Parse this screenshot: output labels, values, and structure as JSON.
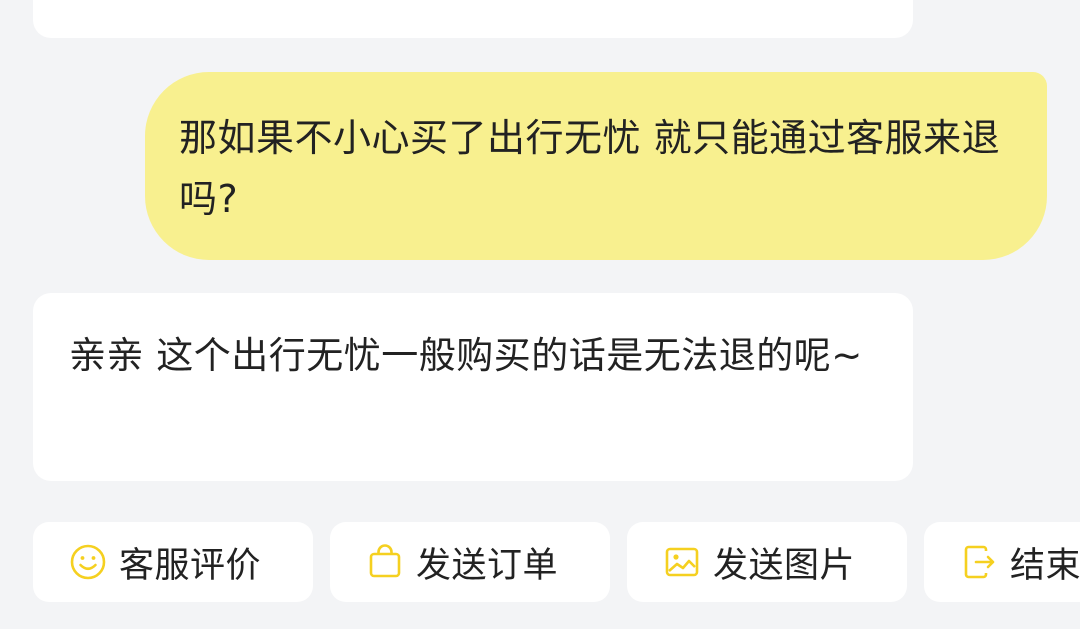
{
  "chat": {
    "messages": [
      {
        "role": "user",
        "text": "那如果不小心买了出行无忧 就只能通过客服来退吗?"
      },
      {
        "role": "agent",
        "text": "亲亲 这个出行无忧一般购买的话是无法退的呢~"
      }
    ]
  },
  "quick_actions": [
    {
      "label": "客服评价",
      "icon": "smiley-icon"
    },
    {
      "label": "发送订单",
      "icon": "shopping-bag-icon"
    },
    {
      "label": "发送图片",
      "icon": "image-icon"
    },
    {
      "label": "结束",
      "icon": "exit-icon"
    }
  ],
  "colors": {
    "background": "#f3f4f6",
    "user_bubble": "#f8f08f",
    "agent_bubble": "#ffffff",
    "icon_accent": "#f5d020",
    "text": "#222222"
  }
}
